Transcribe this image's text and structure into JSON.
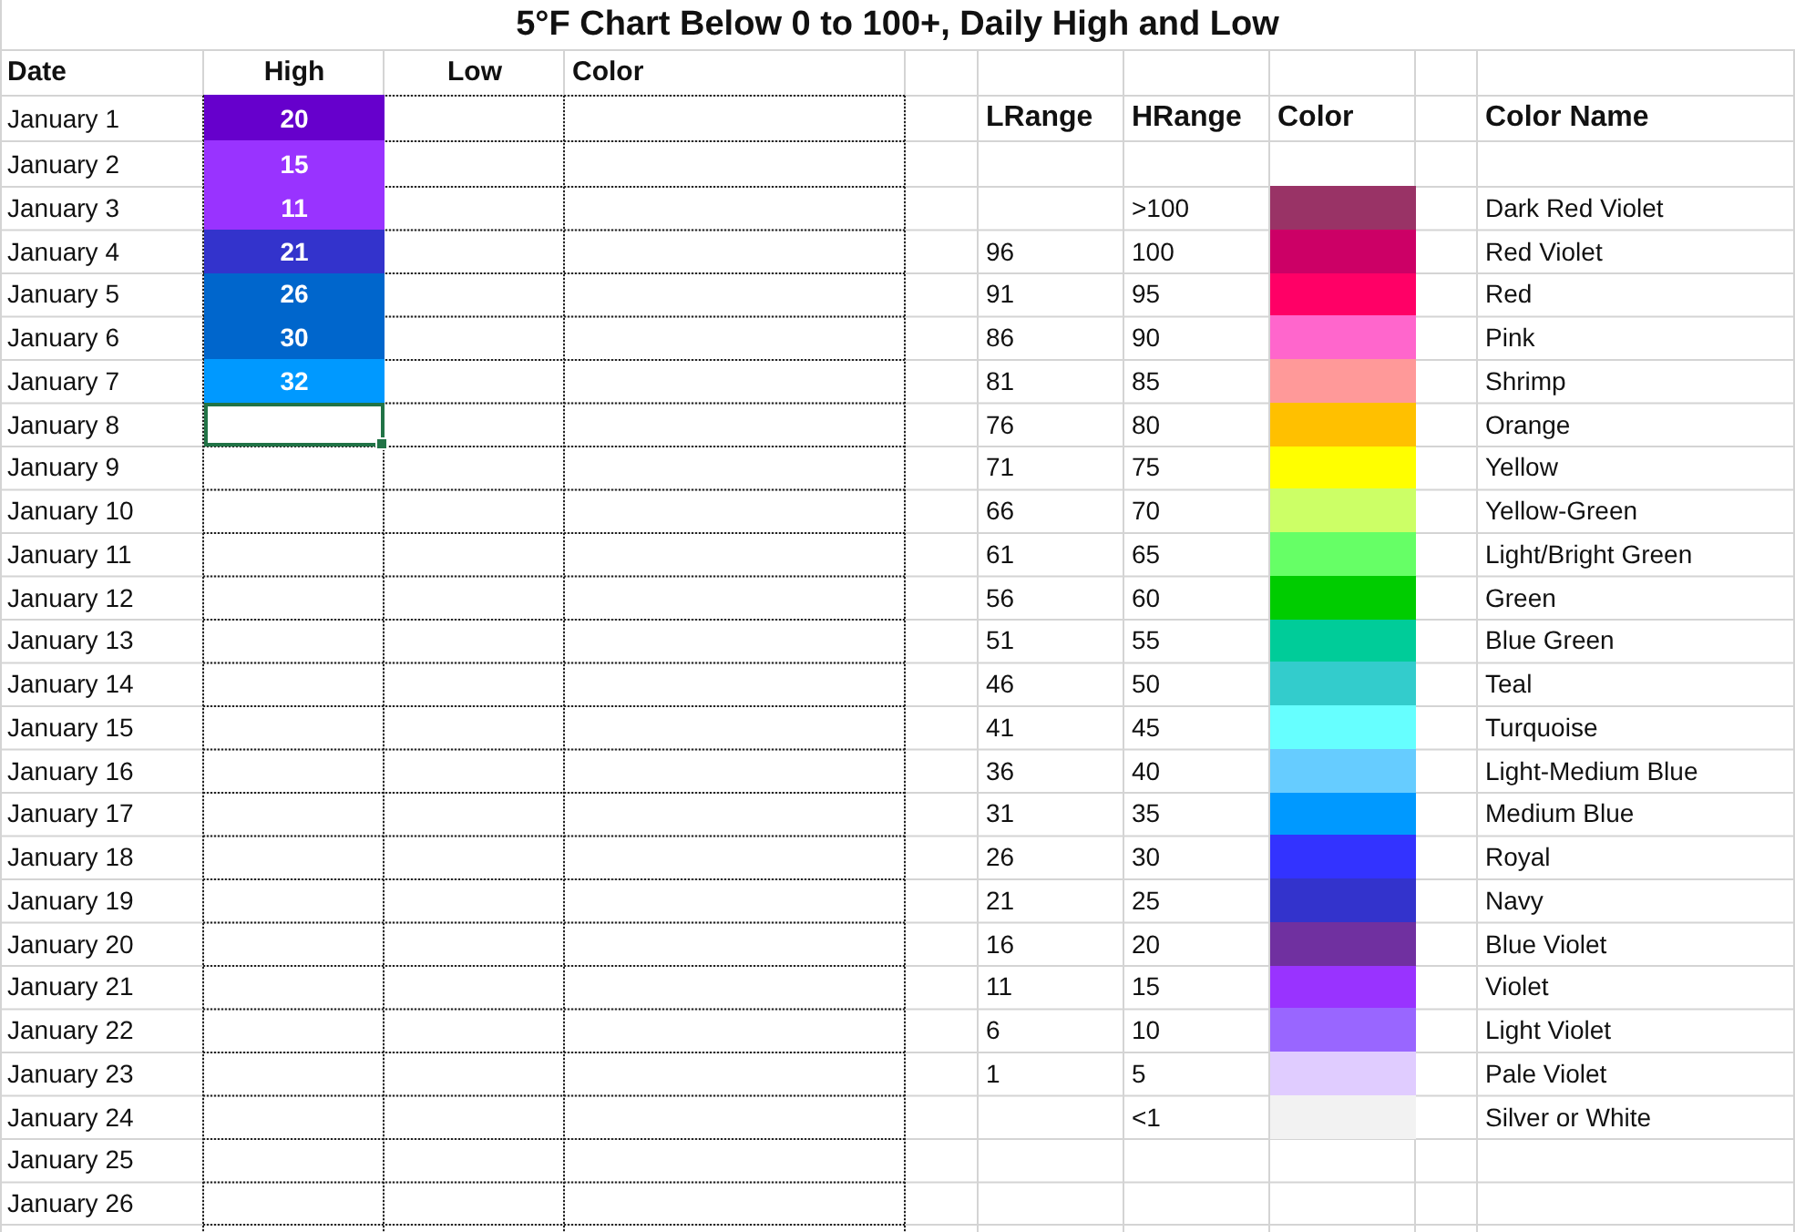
{
  "title": "5°F Chart Below 0 to 100+, Daily High and Low",
  "log": {
    "columns": [
      "Date",
      "High",
      "Low",
      "Color"
    ],
    "rows": [
      {
        "date": "January 1",
        "high": "20",
        "color": "#6600cc",
        "selected": false
      },
      {
        "date": "January 2",
        "high": "15",
        "color": "#9933ff",
        "selected": false
      },
      {
        "date": "January 3",
        "high": "11",
        "color": "#9933ff",
        "selected": false
      },
      {
        "date": "January 4",
        "high": "21",
        "color": "#3333cc",
        "selected": false
      },
      {
        "date": "January 5",
        "high": "26",
        "color": "#0066cc",
        "selected": false
      },
      {
        "date": "January 6",
        "high": "30",
        "color": "#0066cc",
        "selected": false
      },
      {
        "date": "January 7",
        "high": "32",
        "color": "#0099ff",
        "selected": false
      },
      {
        "date": "January 8",
        "selected": true
      },
      {
        "date": "January 9",
        "selected": false
      },
      {
        "date": "January 10",
        "selected": false
      },
      {
        "date": "January 11",
        "selected": false
      },
      {
        "date": "January 12",
        "selected": false
      },
      {
        "date": "January 13",
        "selected": false
      },
      {
        "date": "January 14",
        "selected": false
      },
      {
        "date": "January 15",
        "selected": false
      },
      {
        "date": "January 16",
        "selected": false
      },
      {
        "date": "January 17",
        "selected": false
      },
      {
        "date": "January 18",
        "selected": false
      },
      {
        "date": "January 19",
        "selected": false
      },
      {
        "date": "January 20",
        "selected": false
      },
      {
        "date": "January 21",
        "selected": false
      },
      {
        "date": "January 22",
        "selected": false
      },
      {
        "date": "January 23",
        "selected": false
      },
      {
        "date": "January 24",
        "selected": false
      },
      {
        "date": "January 25",
        "selected": false
      },
      {
        "date": "January 26",
        "selected": false
      }
    ]
  },
  "legend": {
    "columns": [
      "LRange",
      "HRange",
      "Color",
      "Color Name"
    ],
    "rows": [
      {
        "high": ">100",
        "color": "#993366",
        "name": "Dark Red Violet"
      },
      {
        "low": "96",
        "high": "100",
        "color": "#cc0066",
        "name": "Red Violet"
      },
      {
        "low": "91",
        "high": "95",
        "color": "#ff0066",
        "name": "Red"
      },
      {
        "low": "86",
        "high": "90",
        "color": "#ff66cc",
        "name": "Pink"
      },
      {
        "low": "81",
        "high": "85",
        "color": "#ff9999",
        "name": "Shrimp"
      },
      {
        "low": "76",
        "high": "80",
        "color": "#ffc000",
        "name": "Orange"
      },
      {
        "low": "71",
        "high": "75",
        "color": "#ffff00",
        "name": "Yellow"
      },
      {
        "low": "66",
        "high": "70",
        "color": "#ccff66",
        "name": "Yellow-Green"
      },
      {
        "low": "61",
        "high": "65",
        "color": "#66ff66",
        "name": "Light/Bright Green"
      },
      {
        "low": "56",
        "high": "60",
        "color": "#00cc00",
        "name": "Green"
      },
      {
        "low": "51",
        "high": "55",
        "color": "#00cc99",
        "name": "Blue Green"
      },
      {
        "low": "46",
        "high": "50",
        "color": "#33cccc",
        "name": "Teal"
      },
      {
        "low": "41",
        "high": "45",
        "color": "#66ffff",
        "name": "Turquoise"
      },
      {
        "low": "36",
        "high": "40",
        "color": "#66ccff",
        "name": "Light-Medium Blue"
      },
      {
        "low": "31",
        "high": "35",
        "color": "#0099ff",
        "name": "Medium Blue"
      },
      {
        "low": "26",
        "high": "30",
        "color": "#3333ff",
        "name": "Royal"
      },
      {
        "low": "21",
        "high": "25",
        "color": "#3333cc",
        "name": "Navy"
      },
      {
        "low": "16",
        "high": "20",
        "color": "#7030a0",
        "name": "Blue Violet"
      },
      {
        "low": "11",
        "high": "15",
        "color": "#9933ff",
        "name": "Violet"
      },
      {
        "low": "6",
        "high": "10",
        "color": "#9966ff",
        "name": "Light Violet"
      },
      {
        "low": "1",
        "high": "5",
        "color": "#e0ccff",
        "name": "Pale Violet"
      },
      {
        "high": "<1",
        "color": "#f2f2f2",
        "name": "Silver or White"
      }
    ]
  }
}
